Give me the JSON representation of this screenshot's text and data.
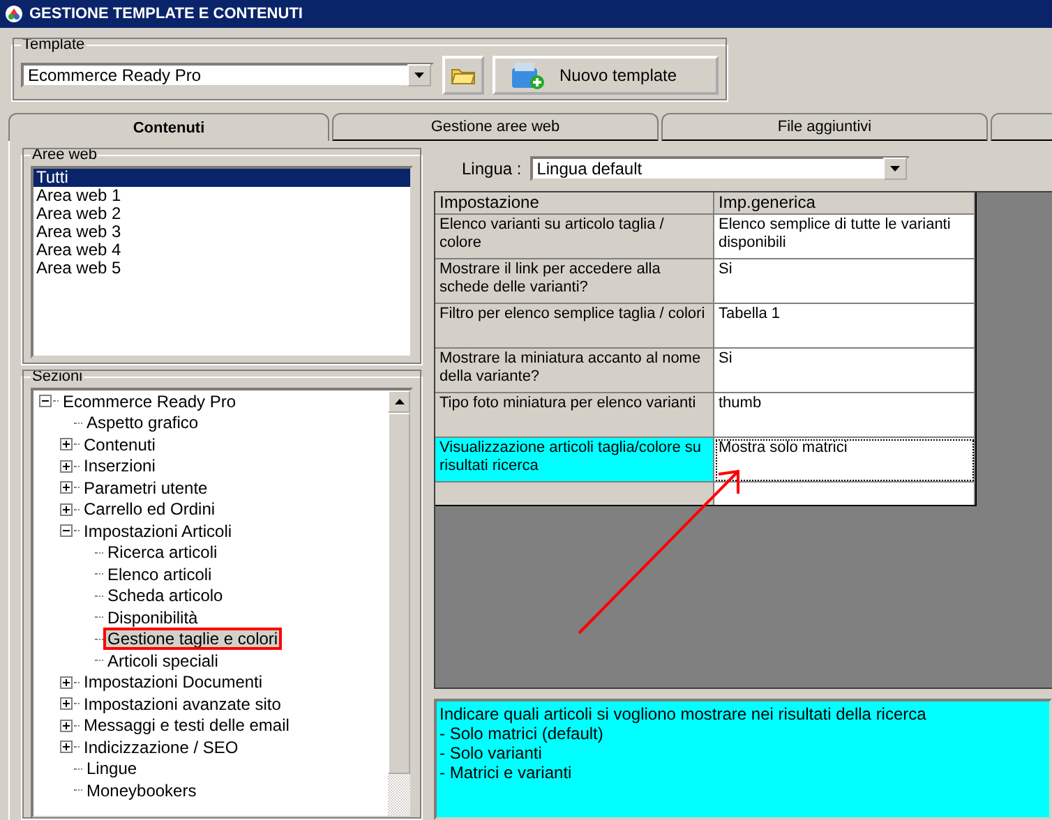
{
  "window": {
    "title": "GESTIONE TEMPLATE E CONTENUTI"
  },
  "template": {
    "label": "Template",
    "value": "Ecommerce Ready Pro",
    "new_button": "Nuovo template"
  },
  "tabs": [
    {
      "label": "Contenuti",
      "selected": true
    },
    {
      "label": "Gestione aree web",
      "selected": false
    },
    {
      "label": "File aggiuntivi",
      "selected": false
    },
    {
      "selected": false
    }
  ],
  "web_areas": {
    "label": "Aree web",
    "items": [
      {
        "label": "Tutti",
        "selected": true
      },
      {
        "label": "Area web 1",
        "selected": false
      },
      {
        "label": "Area web 2",
        "selected": false
      },
      {
        "label": "Area web 3",
        "selected": false
      },
      {
        "label": "Area web 4",
        "selected": false
      },
      {
        "label": "Area web 5",
        "selected": false
      }
    ]
  },
  "sections": {
    "label": "Sezioni",
    "tree": [
      {
        "label": "Ecommerce Ready Pro",
        "kind": "folder",
        "expanded": true,
        "selected": false,
        "children": [
          {
            "label": "Aspetto grafico",
            "kind": "leaf",
            "selected": false
          },
          {
            "label": "Contenuti",
            "kind": "folder",
            "expanded": false,
            "selected": false
          },
          {
            "label": "Inserzioni",
            "kind": "folder",
            "expanded": false,
            "selected": false
          },
          {
            "label": "Parametri utente",
            "kind": "folder",
            "expanded": false,
            "selected": false
          },
          {
            "label": "Carrello ed Ordini",
            "kind": "folder",
            "expanded": false,
            "selected": false
          },
          {
            "label": "Impostazioni Articoli",
            "kind": "folder",
            "expanded": true,
            "selected": false,
            "children": [
              {
                "label": "Ricerca articoli",
                "kind": "leaf",
                "selected": false
              },
              {
                "label": "Elenco articoli",
                "kind": "leaf",
                "selected": false
              },
              {
                "label": "Scheda articolo",
                "kind": "leaf",
                "selected": false
              },
              {
                "label": "Disponibilità",
                "kind": "leaf",
                "selected": false
              },
              {
                "label": "Gestione taglie e colori",
                "kind": "leaf",
                "selected": true
              },
              {
                "label": "Articoli speciali",
                "kind": "leaf",
                "selected": false
              }
            ]
          },
          {
            "label": "Impostazioni Documenti",
            "kind": "folder",
            "expanded": false,
            "selected": false
          },
          {
            "label": "Impostazioni avanzate sito",
            "kind": "folder",
            "expanded": false,
            "selected": false
          },
          {
            "label": "Messaggi e testi delle email",
            "kind": "folder",
            "expanded": false,
            "selected": false
          },
          {
            "label": "Indicizzazione / SEO",
            "kind": "folder",
            "expanded": false,
            "selected": false
          },
          {
            "label": "Lingue",
            "kind": "leaf",
            "selected": false
          },
          {
            "label": "Moneybookers",
            "kind": "leaf",
            "selected": false
          }
        ]
      }
    ]
  },
  "language": {
    "label": "Lingua :",
    "value": "Lingua default"
  },
  "table": {
    "columns": [
      "Impostazione",
      "Imp.generica"
    ],
    "rows": [
      {
        "setting": "Elenco varianti su articolo taglia / colore",
        "value": "Elenco semplice di tutte le varianti disponibili",
        "selected": false
      },
      {
        "setting": "Mostrare il link per accedere alla schede delle varianti?",
        "value": "Si",
        "selected": false
      },
      {
        "setting": "Filtro per elenco semplice taglia / colori",
        "value": "Tabella 1",
        "selected": false
      },
      {
        "setting": "Mostrare la miniatura accanto al nome della variante?",
        "value": "Si",
        "selected": false
      },
      {
        "setting": "Tipo foto miniatura per elenco varianti",
        "value": "thumb",
        "selected": false
      },
      {
        "setting": "Visualizzazione articoli taglia/colore su risultati ricerca",
        "value": "Mostra solo matrici",
        "selected": true
      }
    ]
  },
  "description": [
    "Indicare quali articoli si vogliono mostrare nei risultati della ricerca",
    "- Solo matrici (default)",
    "- Solo varianti",
    "- Matrici e varianti"
  ]
}
